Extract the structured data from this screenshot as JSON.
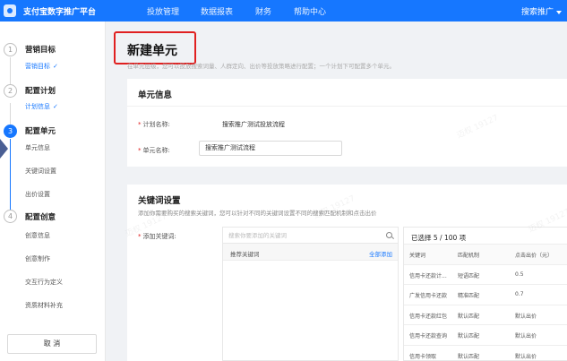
{
  "topbar": {
    "app_title": "支付宝数字推广平台",
    "nav": [
      "投放管理",
      "数据报表",
      "财务",
      "帮助中心"
    ],
    "user_menu": "搜索推广"
  },
  "sidebar": {
    "steps": [
      {
        "index": "1",
        "title": "营销目标",
        "sub": "营销目标",
        "done": true
      },
      {
        "index": "2",
        "title": "配置计划",
        "sub": "计划信息",
        "done": true
      },
      {
        "index": "3",
        "title": "配置单元",
        "items": [
          "单元信息",
          "关键词设置",
          "出价设置"
        ]
      },
      {
        "index": "4",
        "title": "配置创意",
        "items": [
          "创意信息",
          "创意制作",
          "交互行为定义",
          "资质材料补充"
        ]
      }
    ],
    "cancel_label": "取 消"
  },
  "main": {
    "page_title": "新建单元",
    "page_desc": "在单元层级，您可以投放搜索词量、人群定向、出价等投放策略进行配置；一个计划下可配置多个单元。",
    "unit_info": {
      "title": "单元信息",
      "plan_name_label": "计划名称:",
      "plan_name_value": "搜索推广测试投放流程",
      "unit_name_label": "单元名称:",
      "unit_name_value": "搜索推广测试流程"
    },
    "keyword_settings": {
      "title": "关键词设置",
      "desc": "添加你需要购买的搜索关键词，您可以针对不同的关键词设置不同的搜索匹配机制和点击出价",
      "add_label": "添加关键词:",
      "search_placeholder": "搜索你要添加的关键词",
      "recommend_label": "推荐关键词",
      "add_all_label": "全部添加",
      "selected_label": "已选择 5 / 100 项",
      "columns": [
        "关键词",
        "匹配机制",
        "点击出价（元）"
      ],
      "rows": [
        [
          "信用卡还款计...",
          "短语匹配",
          "0.5"
        ],
        [
          "广发信用卡还款",
          "精准匹配",
          "0.7"
        ],
        [
          "信用卡还款红包",
          "默认匹配",
          "默认出价"
        ],
        [
          "信用卡还款查询",
          "默认匹配",
          "默认出价"
        ],
        [
          "信用卡领取",
          "默认匹配",
          "默认出价"
        ]
      ]
    }
  },
  "watermark": "迈权 19127",
  "colors": {
    "primary": "#1677ff",
    "highlight": "#e02020"
  }
}
